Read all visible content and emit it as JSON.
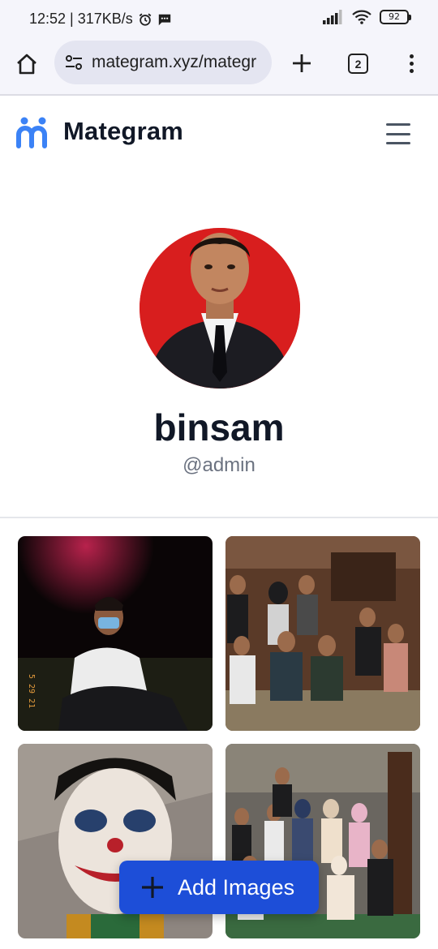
{
  "status_bar": {
    "time_speed": "12:52 | 317KB/s",
    "battery": "92"
  },
  "browser": {
    "url": "mategram.xyz/mategr",
    "tab_count": "2"
  },
  "site": {
    "brand": "Mategram",
    "accent_color": "#3b82f6"
  },
  "profile": {
    "display_name": "binsam",
    "username": "@admin"
  },
  "gallery": {
    "count": 4
  },
  "actions": {
    "add_images_label": "Add Images"
  }
}
